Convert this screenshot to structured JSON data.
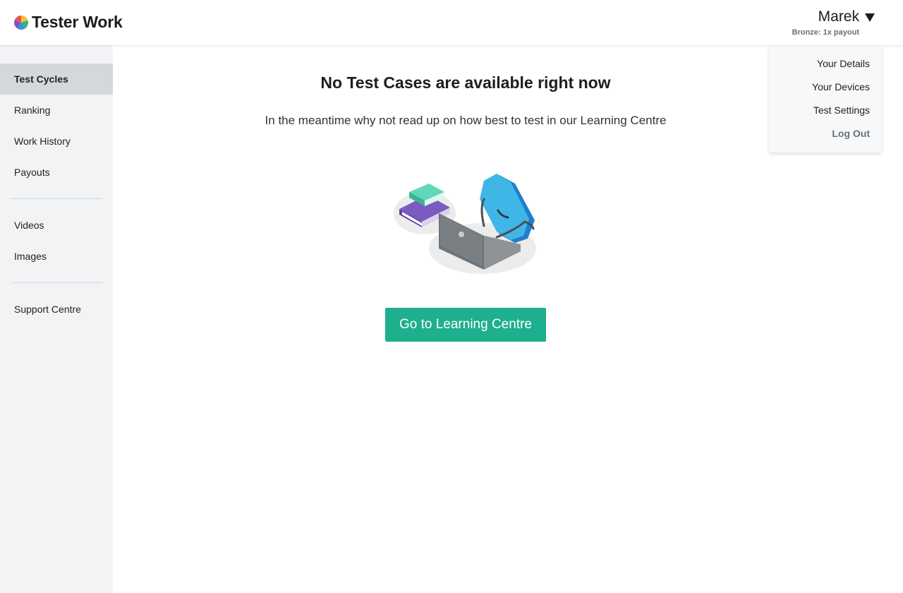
{
  "app": {
    "name": "Tester Work",
    "logo_icon": "color-wheel-logo"
  },
  "user": {
    "name": "Marek",
    "tier": "Bronze: 1x payout",
    "menu_icon": "caret-down-icon"
  },
  "user_menu": [
    "Your Details",
    "Your Devices",
    "Test Settings",
    "Log Out"
  ],
  "sidebar": {
    "groups": [
      [
        "Test Cycles",
        "Ranking",
        "Work History",
        "Payouts"
      ],
      [
        "Videos",
        "Images"
      ],
      [
        "Support Centre"
      ]
    ],
    "active": "Test Cycles"
  },
  "empty_state": {
    "title": "No Test Cases are available right now",
    "message": "In the meantime why not read up on how best to test in our Learning Centre",
    "illustration": "books-laptop-badge-illustration",
    "button_label": "Go to Learning Centre"
  },
  "colors": {
    "accent": "#1eaf8e",
    "sidebar_bg": "#f2f3f5",
    "active_nav_bg": "#d3d8dc",
    "badge_blue": "#3fb6e6",
    "book_purple": "#7b5bbf",
    "book_teal": "#5ed8b8",
    "laptop_gray": "#7a7f84"
  }
}
